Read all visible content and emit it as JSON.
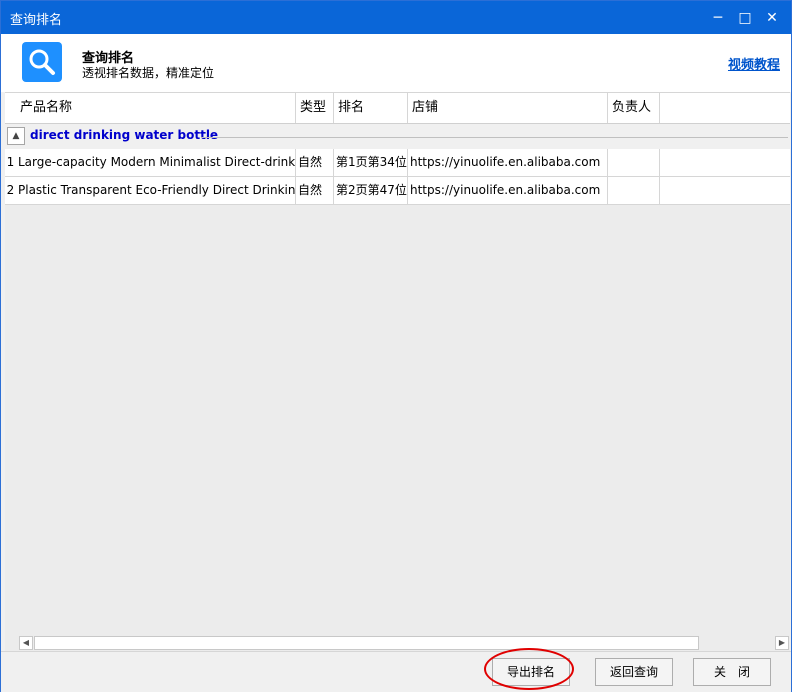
{
  "window": {
    "title": "查询排名",
    "minimize_glyph": "─",
    "maximize_glyph": "□",
    "close_glyph": "✕"
  },
  "header": {
    "title": "查询排名",
    "subtitle": "透视排名数据，精准定位",
    "video_link": "视频教程",
    "icon": "search-icon"
  },
  "table": {
    "columns": [
      "产品名称",
      "类型",
      "排名",
      "店铺",
      "负责人"
    ],
    "group": {
      "label": "direct drinking water bottle",
      "toggle_glyph": "▲"
    },
    "rows": [
      {
        "no": "1",
        "product": "Large-capacity Modern Minimalist Direct-drink Student Water Cup",
        "type": "自然",
        "rank": "第1页第34位",
        "store": "https://yinuolife.en.alibaba.com",
        "owner": ""
      },
      {
        "no": "2",
        "product": "Plastic Transparent Eco-Friendly Direct Drinking Water Bottle",
        "type": "自然",
        "rank": "第2页第47位",
        "store": "https://yinuolife.en.alibaba.com",
        "owner": ""
      }
    ]
  },
  "footer": {
    "export_label": "导出排名",
    "back_label": "返回查询",
    "close_label": "关　闭"
  },
  "colors": {
    "titlebar": "#0a66d8",
    "group_label": "#0000cc",
    "link": "#0055cc",
    "highlight": "#e00000"
  }
}
